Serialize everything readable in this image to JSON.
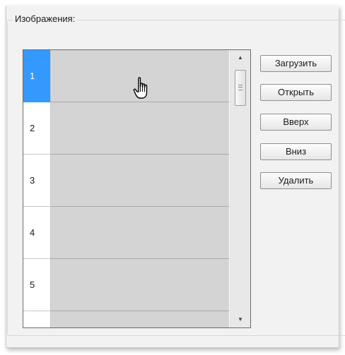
{
  "window": {
    "group_title": "Изображения:"
  },
  "grid": {
    "selected_row": 1,
    "rows": [
      {
        "number": "1"
      },
      {
        "number": "2"
      },
      {
        "number": "3"
      },
      {
        "number": "4"
      },
      {
        "number": "5"
      },
      {
        "number": ""
      }
    ]
  },
  "buttons": {
    "upload": "Загрузить",
    "open": "Открыть",
    "up": "Вверх",
    "down": "Вниз",
    "delete": "Удалить"
  },
  "icons": {
    "cursor": "hand-pointer-icon",
    "scroll_up": "scroll-up-arrow-icon",
    "scroll_down": "scroll-down-arrow-icon"
  },
  "colors": {
    "selection": "#3399ff",
    "cell_background": "#d4d4d4",
    "panel_background": "#f2f2f2"
  }
}
